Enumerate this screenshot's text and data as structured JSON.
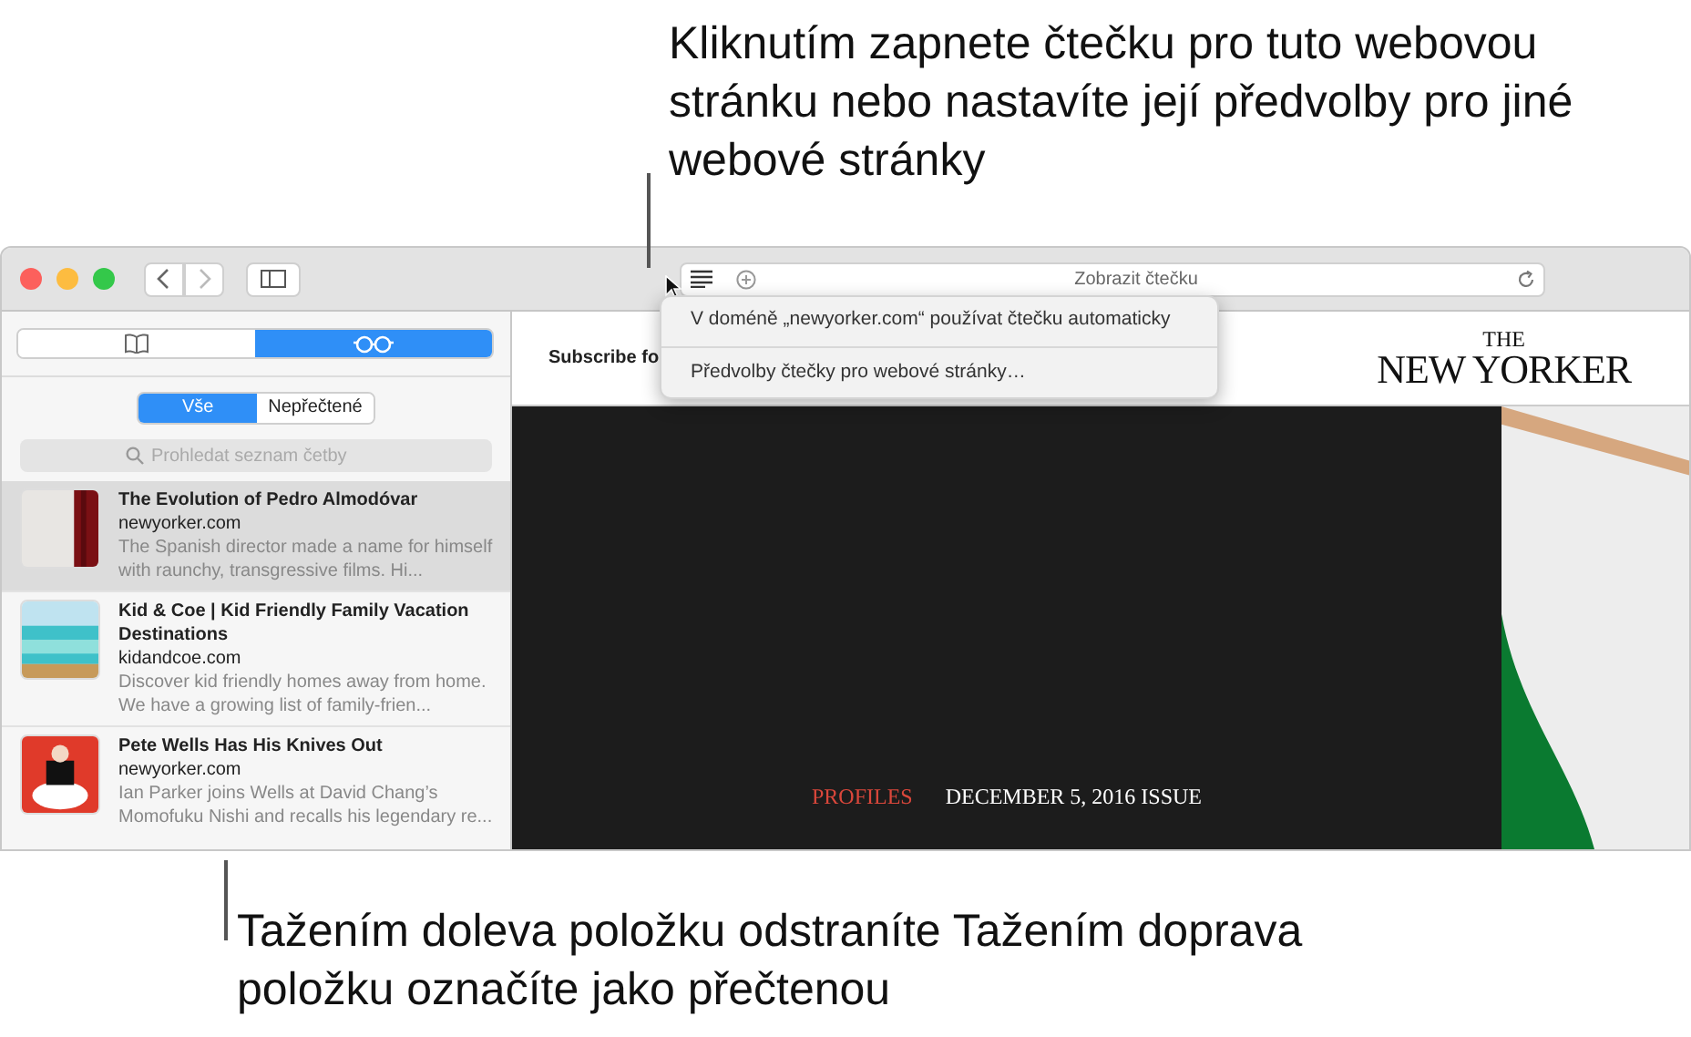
{
  "callout_top": "Kliknutím zapnete čtečku pro tuto webovou stránku nebo nastavíte její předvolby pro jiné webové stránky",
  "address_bar": {
    "title": "Zobrazit čtečku"
  },
  "reader_menu": {
    "items": [
      "V doméně „newyorker.com“ používat čtečku automaticky",
      "Předvolby čtečky pro webové stránky…"
    ]
  },
  "sidebar": {
    "modes": [
      {
        "kind": "bookmarks",
        "selected": false
      },
      {
        "kind": "reading-list",
        "selected": true
      }
    ],
    "filters": [
      {
        "label": "Vše",
        "selected": true
      },
      {
        "label": "Nepřečtené",
        "selected": false
      }
    ],
    "search": {
      "placeholder": "Prohledat seznam četby"
    },
    "items": [
      {
        "title": "The Evolution of Pedro Almodóvar",
        "site": "newyorker.com",
        "summary": "The Spanish director made a name for himself with raunchy, transgressive films. Hi...",
        "selected": true
      },
      {
        "title": "Kid & Coe | Kid Friendly Family Vacation Destinations",
        "site": "kidandcoe.com",
        "summary": "Discover kid friendly homes away from home. We have a growing list of family-frien...",
        "selected": false
      },
      {
        "title": "Pete Wells Has His Knives Out",
        "site": "newyorker.com",
        "summary": "Ian Parker joins Wells at David Chang’s Momofuku Nishi and recalls his legendary re...",
        "selected": false
      }
    ]
  },
  "page": {
    "subscribe": "Subscribe fo",
    "logo_top": "THE",
    "logo": "NEW YORKER",
    "section": "PROFILES",
    "issue": "DECEMBER 5, 2016 ISSUE"
  },
  "callout_bottom": "Tažením doleva položku odstraníte Tažením doprava položku označíte jako přečtenou"
}
